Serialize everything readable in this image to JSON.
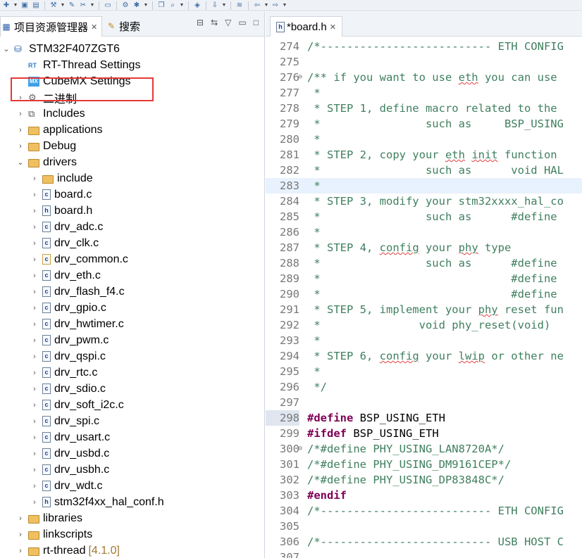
{
  "left_panel": {
    "tab_project": "项目资源管理器",
    "tab_search": "搜索",
    "tree": [
      {
        "label": "STM32F407ZGT6",
        "depth": 0,
        "arrow": "down",
        "icon": "project-icon"
      },
      {
        "label": "RT-Thread Settings",
        "depth": 1,
        "arrow": "",
        "icon": "rt-settings-icon"
      },
      {
        "label": "CubeMX Settings",
        "depth": 1,
        "arrow": "",
        "icon": "cubemx-icon"
      },
      {
        "label": "二进制",
        "depth": 1,
        "arrow": "right",
        "icon": "binary-icon"
      },
      {
        "label": "Includes",
        "depth": 1,
        "arrow": "right",
        "icon": "includes-icon"
      },
      {
        "label": "applications",
        "depth": 1,
        "arrow": "right",
        "icon": "folder-icon"
      },
      {
        "label": "Debug",
        "depth": 1,
        "arrow": "right",
        "icon": "folder-icon"
      },
      {
        "label": "drivers",
        "depth": 1,
        "arrow": "down",
        "icon": "folder-icon"
      },
      {
        "label": "include",
        "depth": 2,
        "arrow": "right",
        "icon": "folder-icon"
      },
      {
        "label": "board.c",
        "depth": 2,
        "arrow": "right",
        "icon": "c-file-icon"
      },
      {
        "label": "board.h",
        "depth": 2,
        "arrow": "right",
        "icon": "h-file-icon"
      },
      {
        "label": "drv_adc.c",
        "depth": 2,
        "arrow": "right",
        "icon": "c-file-icon"
      },
      {
        "label": "drv_clk.c",
        "depth": 2,
        "arrow": "right",
        "icon": "c-file-icon"
      },
      {
        "label": "drv_common.c",
        "depth": 2,
        "arrow": "right",
        "icon": "c-file-warning-icon"
      },
      {
        "label": "drv_eth.c",
        "depth": 2,
        "arrow": "right",
        "icon": "c-file-icon"
      },
      {
        "label": "drv_flash_f4.c",
        "depth": 2,
        "arrow": "right",
        "icon": "c-file-icon"
      },
      {
        "label": "drv_gpio.c",
        "depth": 2,
        "arrow": "right",
        "icon": "c-file-icon"
      },
      {
        "label": "drv_hwtimer.c",
        "depth": 2,
        "arrow": "right",
        "icon": "c-file-icon"
      },
      {
        "label": "drv_pwm.c",
        "depth": 2,
        "arrow": "right",
        "icon": "c-file-icon"
      },
      {
        "label": "drv_qspi.c",
        "depth": 2,
        "arrow": "right",
        "icon": "c-file-icon"
      },
      {
        "label": "drv_rtc.c",
        "depth": 2,
        "arrow": "right",
        "icon": "c-file-icon"
      },
      {
        "label": "drv_sdio.c",
        "depth": 2,
        "arrow": "right",
        "icon": "c-file-icon"
      },
      {
        "label": "drv_soft_i2c.c",
        "depth": 2,
        "arrow": "right",
        "icon": "c-file-icon"
      },
      {
        "label": "drv_spi.c",
        "depth": 2,
        "arrow": "right",
        "icon": "c-file-icon"
      },
      {
        "label": "drv_usart.c",
        "depth": 2,
        "arrow": "right",
        "icon": "c-file-icon"
      },
      {
        "label": "drv_usbd.c",
        "depth": 2,
        "arrow": "right",
        "icon": "c-file-icon"
      },
      {
        "label": "drv_usbh.c",
        "depth": 2,
        "arrow": "right",
        "icon": "c-file-icon"
      },
      {
        "label": "drv_wdt.c",
        "depth": 2,
        "arrow": "right",
        "icon": "c-file-icon"
      },
      {
        "label": "stm32f4xx_hal_conf.h",
        "depth": 2,
        "arrow": "right",
        "icon": "h-file-icon"
      },
      {
        "label": "libraries",
        "depth": 1,
        "arrow": "right",
        "icon": "folder-icon"
      },
      {
        "label": "linkscripts",
        "depth": 1,
        "arrow": "right",
        "icon": "folder-icon"
      },
      {
        "label": "rt-thread",
        "depth": 1,
        "arrow": "right",
        "icon": "folder-icon",
        "badge": "[4.1.0]"
      }
    ]
  },
  "editor": {
    "tab_label": "*board.h",
    "current_line": 283,
    "marked_line": 298,
    "lines": [
      {
        "n": "274",
        "kind": "cm",
        "text": "/*-------------------------- ETH CONFIG"
      },
      {
        "n": "275",
        "kind": "plain",
        "text": ""
      },
      {
        "n": "276",
        "kind": "cm",
        "fold": true,
        "text": "/** if you want to use eth you can use"
      },
      {
        "n": "277",
        "kind": "cm",
        "text": " *"
      },
      {
        "n": "278",
        "kind": "cm",
        "text": " * STEP 1, define macro related to the"
      },
      {
        "n": "279",
        "kind": "cm",
        "text": " *                such as     BSP_USING"
      },
      {
        "n": "280",
        "kind": "cm",
        "text": " *"
      },
      {
        "n": "281",
        "kind": "cm",
        "text": " * STEP 2, copy your eth init function"
      },
      {
        "n": "282",
        "kind": "cm",
        "text": " *                such as      void HAL"
      },
      {
        "n": "283",
        "kind": "cm",
        "text": " *"
      },
      {
        "n": "284",
        "kind": "cm",
        "text": " * STEP 3, modify your stm32xxxx_hal_co"
      },
      {
        "n": "285",
        "kind": "cm",
        "text": " *                such as      #define"
      },
      {
        "n": "286",
        "kind": "cm",
        "text": " *"
      },
      {
        "n": "287",
        "kind": "cm",
        "text": " * STEP 4, config your phy type"
      },
      {
        "n": "288",
        "kind": "cm",
        "text": " *                such as      #define"
      },
      {
        "n": "289",
        "kind": "cm",
        "text": " *                             #define"
      },
      {
        "n": "290",
        "kind": "cm",
        "text": " *                             #define"
      },
      {
        "n": "291",
        "kind": "cm",
        "text": " * STEP 5, implement your phy reset fun"
      },
      {
        "n": "292",
        "kind": "cm",
        "text": " *               void phy_reset(void)"
      },
      {
        "n": "293",
        "kind": "cm",
        "text": " *"
      },
      {
        "n": "294",
        "kind": "cm",
        "text": " * STEP 6, config your lwip or other ne"
      },
      {
        "n": "295",
        "kind": "cm",
        "text": " *"
      },
      {
        "n": "296",
        "kind": "cm",
        "text": " */"
      },
      {
        "n": "297",
        "kind": "plain",
        "text": ""
      },
      {
        "n": "298",
        "kind": "define",
        "kw": "#define",
        "text": " BSP_USING_ETH"
      },
      {
        "n": "299",
        "kind": "define",
        "kw": "#ifdef",
        "text": " BSP_USING_ETH"
      },
      {
        "n": "300",
        "kind": "cm",
        "fold": true,
        "text": "/*#define PHY_USING_LAN8720A*/"
      },
      {
        "n": "301",
        "kind": "cm",
        "text": "/*#define PHY_USING_DM9161CEP*/"
      },
      {
        "n": "302",
        "kind": "cm",
        "text": "/*#define PHY_USING_DP83848C*/"
      },
      {
        "n": "303",
        "kind": "define",
        "kw": "#endif",
        "text": ""
      },
      {
        "n": "304",
        "kind": "cm",
        "text": "/*-------------------------- ETH CONFIG"
      },
      {
        "n": "305",
        "kind": "plain",
        "text": ""
      },
      {
        "n": "306",
        "kind": "cm",
        "text": "/*-------------------------- USB HOST C"
      },
      {
        "n": "307",
        "kind": "plain",
        "text": ""
      }
    ]
  }
}
